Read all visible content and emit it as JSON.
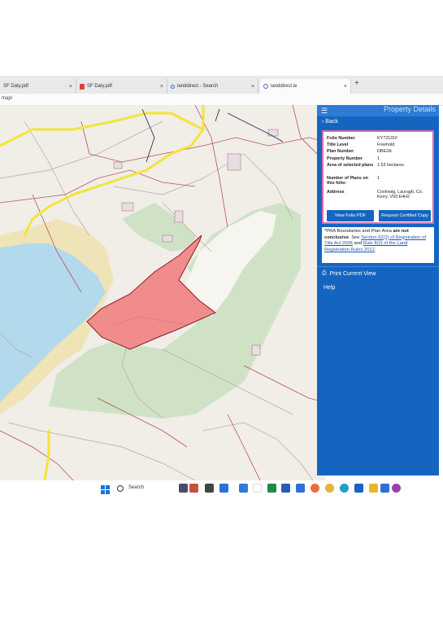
{
  "browser": {
    "tabs": [
      {
        "label": "SF Daly.pdf",
        "icon": "pdf-icon"
      },
      {
        "label": "SF Daly.pdf",
        "icon": "pdf-icon"
      },
      {
        "label": "landdirect - Search",
        "icon": "search-icon"
      },
      {
        "label": "landdirect.ie",
        "icon": "globe-icon"
      }
    ],
    "new_tab": "+",
    "close": "×",
    "url": "map/"
  },
  "panel": {
    "title": "Property Details",
    "back": "Back",
    "details": [
      {
        "label": "Folio Number",
        "value": "KY72131F"
      },
      {
        "label": "Title Level",
        "value": "Freehold"
      },
      {
        "label": "Plan Number",
        "value": "DBE2A"
      },
      {
        "label": "Property Number",
        "value": "1"
      },
      {
        "label": "Area of selected plans",
        "value": "1.53 hectares."
      },
      {
        "label": "Number of Plans on this folio:",
        "value": "1"
      },
      {
        "label": "Address",
        "value": "Coolowig, Lauragh, Co. Kerry, V93 E4H2"
      }
    ],
    "view_folio_button": "View Folio PDF",
    "certified_copy_button": "Request Certified Copy",
    "notice": {
      "text1": "*PRA Boundaries and Plan Area",
      "bold": "are not conclusive",
      "text2": ". See",
      "link1": "Section 62(2) of Registration of Title Act 2006",
      "text3": "and",
      "link2": "Rule 8(3) of the Land Registration Rules 2012",
      "end": "."
    },
    "print": "Print Current View",
    "help": "Help"
  },
  "taskbar": {
    "search_label": "Search"
  },
  "colors": {
    "panel_blue": "#1565c0",
    "highlight_pink": "#f08c8c",
    "water": "#b3d9ec",
    "forest": "#cfe2c6",
    "road_yellow": "#f2e53a"
  }
}
